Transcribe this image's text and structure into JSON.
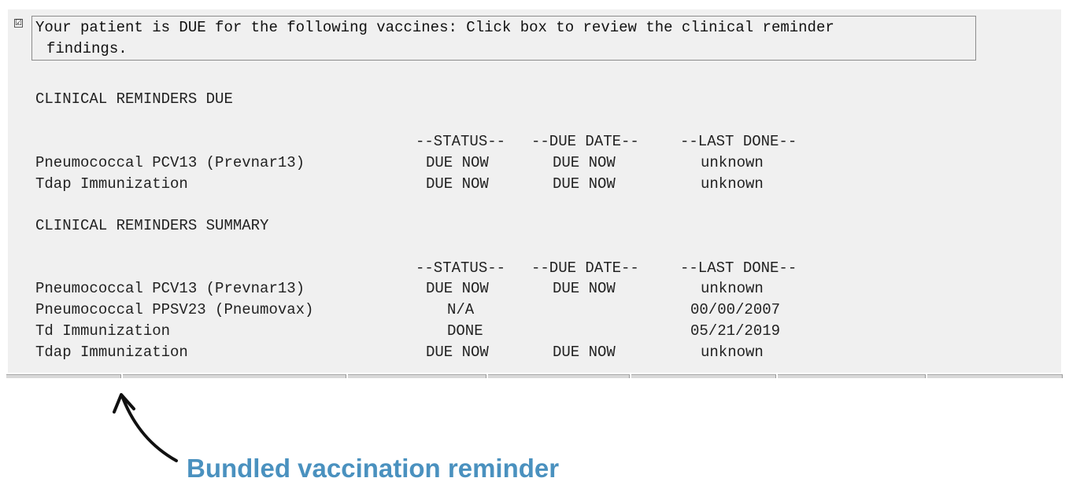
{
  "checkbox": {
    "checked": true,
    "mark": "☑"
  },
  "reminder": {
    "line1": "Your patient is DUE for the following vaccines: Click box to review the clinical reminder",
    "line2": "findings."
  },
  "due_section": {
    "title": "CLINICAL REMINDERS DUE",
    "headers": {
      "status": "--STATUS--",
      "due_date": "--DUE DATE--",
      "last_done": "--LAST DONE--"
    },
    "rows": [
      {
        "name": "Pneumococcal PCV13 (Prevnar13)",
        "status": "DUE NOW",
        "due_date": "DUE NOW",
        "last_done": "unknown"
      },
      {
        "name": "Tdap Immunization",
        "status": "DUE NOW",
        "due_date": "DUE NOW",
        "last_done": "unknown"
      }
    ]
  },
  "summary_section": {
    "title": "CLINICAL REMINDERS SUMMARY",
    "headers": {
      "status": "--STATUS--",
      "due_date": "--DUE DATE--",
      "last_done": "--LAST DONE--"
    },
    "rows": [
      {
        "name": "Pneumococcal PCV13 (Prevnar13)",
        "status": "DUE NOW",
        "due_date": "DUE NOW",
        "last_done": "unknown"
      },
      {
        "name": "Pneumococcal PPSV23 (Pneumovax)",
        "status": "N/A",
        "due_date": "",
        "last_done": "00/00/2007"
      },
      {
        "name": "Td Immunization",
        "status": "DONE",
        "due_date": "",
        "last_done": "05/21/2019"
      },
      {
        "name": "Tdap Immunization",
        "status": "DUE NOW",
        "due_date": "DUE NOW",
        "last_done": "unknown"
      }
    ]
  },
  "annotation": {
    "caption": "Bundled vaccination reminder",
    "color": "#4a91bf"
  }
}
